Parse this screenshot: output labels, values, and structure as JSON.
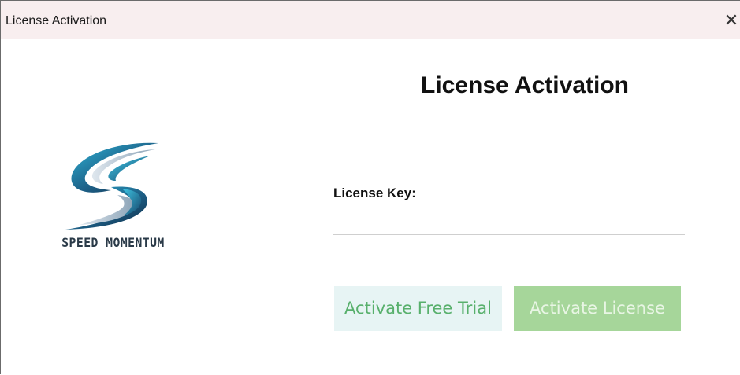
{
  "window": {
    "title": "License Activation",
    "close_glyph": "✕"
  },
  "brand": {
    "logo_icon": "swirl-s-logo-icon",
    "name": "SPEED MOMENTUM"
  },
  "main": {
    "heading": "License Activation",
    "license_key_label": "License Key:",
    "license_key_value": "",
    "license_key_placeholder": ""
  },
  "buttons": {
    "free_trial_label": "Activate Free Trial",
    "activate_label": "Activate License"
  },
  "colors": {
    "titlebar_bg": "#f8eeef",
    "trial_bg": "#e7f4f4",
    "trial_text": "#58b06c",
    "license_bg": "#a6d69a",
    "license_text": "#e8f5e4"
  }
}
